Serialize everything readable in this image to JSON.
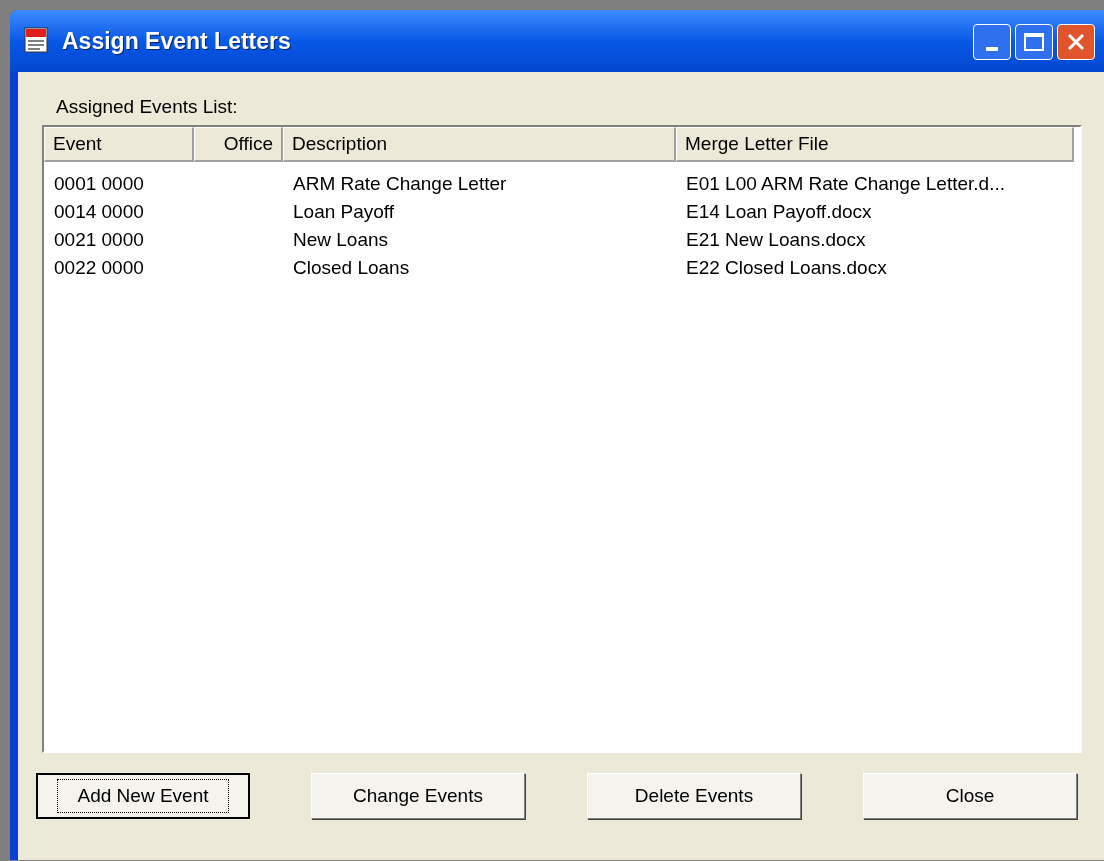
{
  "window": {
    "title": "Assign Event Letters"
  },
  "list_label": "Assigned Events List:",
  "table": {
    "columns": [
      {
        "label": "Event"
      },
      {
        "label": "Office"
      },
      {
        "label": "Description"
      },
      {
        "label": "Merge Letter File"
      }
    ],
    "rows": [
      {
        "cells": [
          "0001 0000",
          "",
          "ARM Rate Change Letter",
          "E01 L00 ARM Rate Change Letter.d..."
        ]
      },
      {
        "cells": [
          "0014 0000",
          "",
          "Loan Payoff",
          "E14 Loan Payoff.docx"
        ]
      },
      {
        "cells": [
          "0021 0000",
          "",
          "New Loans",
          "E21 New Loans.docx"
        ]
      },
      {
        "cells": [
          "0022 0000",
          "",
          "Closed Loans",
          "E22 Closed Loans.docx"
        ]
      }
    ]
  },
  "buttons": [
    {
      "label": "Add New Event",
      "focused": true
    },
    {
      "label": "Change Events",
      "focused": false
    },
    {
      "label": "Delete Events",
      "focused": false
    },
    {
      "label": "Close",
      "focused": false
    }
  ]
}
